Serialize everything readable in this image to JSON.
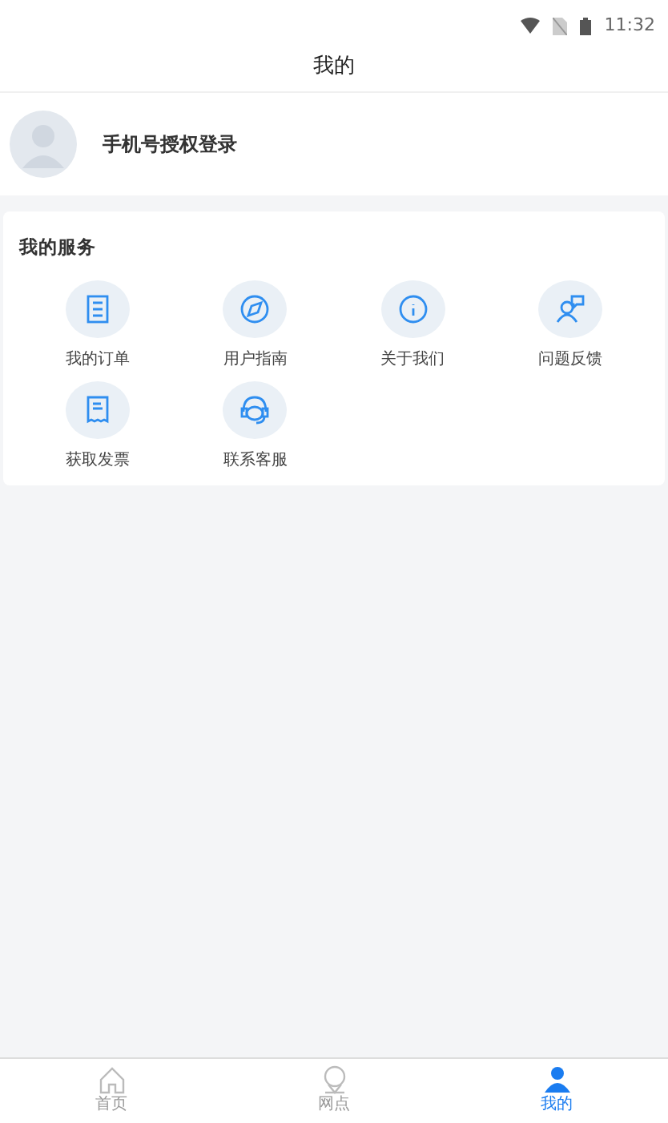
{
  "status_bar": {
    "time": "11:32"
  },
  "header": {
    "title": "我的"
  },
  "profile": {
    "login_text": "手机号授权登录"
  },
  "services": {
    "title": "我的服务",
    "items": [
      {
        "kind": "orders",
        "label": "我的订单"
      },
      {
        "kind": "guide",
        "label": "用户指南"
      },
      {
        "kind": "about",
        "label": "关于我们"
      },
      {
        "kind": "feedback",
        "label": "问题反馈"
      },
      {
        "kind": "invoice",
        "label": "获取发票"
      },
      {
        "kind": "support",
        "label": "联系客服"
      }
    ]
  },
  "tab_bar": [
    {
      "kind": "home",
      "label": "首页",
      "selected": false
    },
    {
      "kind": "outlet",
      "label": "网点",
      "selected": false
    },
    {
      "kind": "mine",
      "label": "我的",
      "selected": true
    }
  ]
}
